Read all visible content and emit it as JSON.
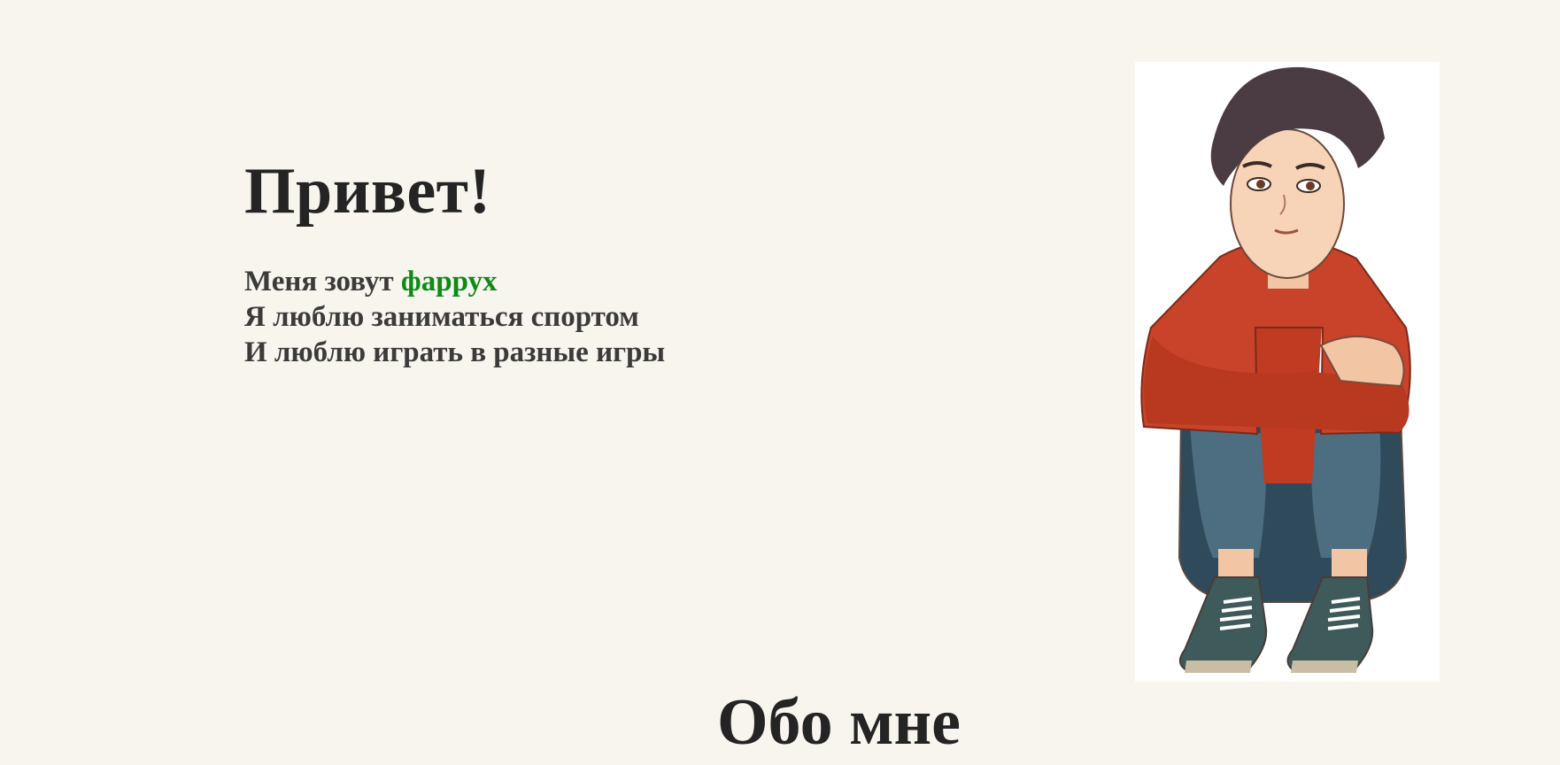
{
  "hero": {
    "title": "Привет!",
    "line1_prefix": "Меня зовут",
    "line1_name": "фаррух",
    "line2": "Я люблю заниматься спортом",
    "line3": "И люблю играть в разные игры"
  },
  "photo": {
    "subject": "cartoon-boy-sitting"
  },
  "about": {
    "title": "Обо мне"
  },
  "colors": {
    "background": "#f8f5ef",
    "text": "#2b2b2b",
    "accent_name": "#0e8a17",
    "jacket": "#c8432a",
    "pants": "#3e5d6e"
  }
}
